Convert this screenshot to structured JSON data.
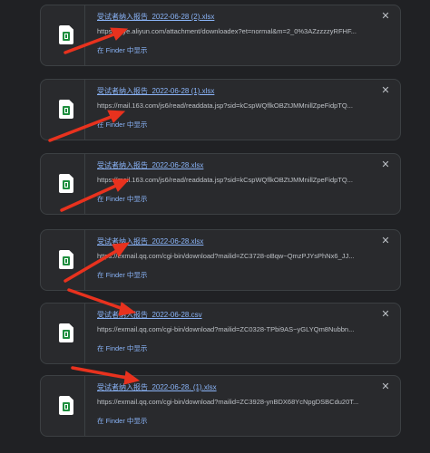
{
  "downloads": [
    {
      "filename": "受试者纳入报告_2022-06-28 (2).xlsx",
      "url": "https://qiye.aliyun.com/attachment/downloadex?et=normal&m=2_0%3AZzzzzyRFHF...",
      "action": "在 Finder 中显示",
      "close": "✕"
    },
    {
      "filename": "受试者纳入报告_2022-06-28 (1).xlsx",
      "url": "https://mail.163.com/js6/read/readdata.jsp?sid=kCspWQflkOBZtJMMnillZpeFidpTQ...",
      "action": "在 Finder 中显示",
      "close": "✕"
    },
    {
      "filename": "受试者纳入报告_2022-06-28.xlsx",
      "url": "https://mail.163.com/js6/read/readdata.jsp?sid=kCspWQflkOBZtJMMnillZpeFidpTQ...",
      "action": "在 Finder 中显示",
      "close": "✕"
    },
    {
      "filename": "受试者纳入报告_2022-06-28.xlsx",
      "url": "https://exmail.qq.com/cgi-bin/download?mailid=ZC3728-oBqw~QmzPJYsPhNx6_JJ...",
      "action": "在 Finder 中显示",
      "close": "✕"
    },
    {
      "filename": "受试者纳入报告_2022-06-28.csv",
      "url": "https://exmail.qq.com/cgi-bin/download?mailid=ZC0328-TPbi9AS~yGLYQm8Nubbn...",
      "action": "在 Finder 中显示",
      "close": "✕"
    },
    {
      "filename": "受试者纳入报告_2022-06-28. (1).xlsx",
      "url": "https://exmail.qq.com/cgi-bin/download?mailid=ZC3928-ynBDX68YcNpgDSBCdu20T...",
      "action": "在 Finder 中显示",
      "close": "✕"
    }
  ],
  "colors": {
    "background": "#202124",
    "card": "#292a2d",
    "link": "#8ab4f8",
    "url_text": "#bdc1c6",
    "annotation_arrow": "#e8321e",
    "file_icon_sheet": "#1e8e3e"
  },
  "icons": {
    "file": "spreadsheet-file-icon",
    "close": "close-icon",
    "annotation": "red-arrow-annotation"
  }
}
